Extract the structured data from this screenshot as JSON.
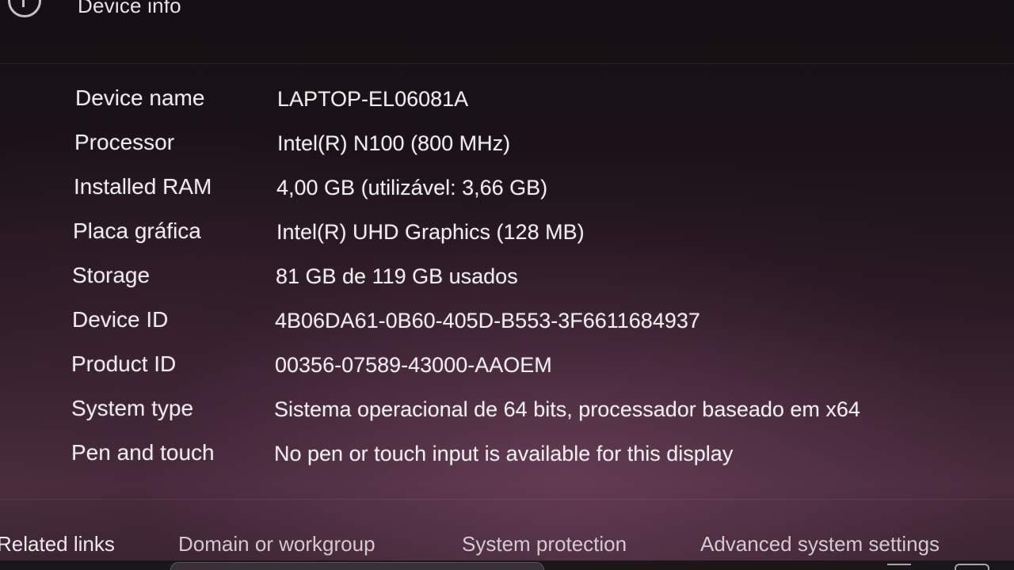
{
  "header": {
    "title": "Device info",
    "icon": "info-icon"
  },
  "specs": [
    {
      "label": "Device name",
      "value": "LAPTOP-EL06081A"
    },
    {
      "label": "Processor",
      "value": "Intel(R) N100 (800 MHz)"
    },
    {
      "label": "Installed RAM",
      "value": "4,00 GB (utilizável: 3,66 GB)"
    },
    {
      "label": "Placa gráfica",
      "value": "Intel(R) UHD Graphics (128 MB)"
    },
    {
      "label": "Storage",
      "value": "81 GB de 119 GB usados"
    },
    {
      "label": "Device ID",
      "value": "4B06DA61-0B60-405D-B553-3F6611684937"
    },
    {
      "label": "Product ID",
      "value": "00356-07589-43000-AAOEM"
    },
    {
      "label": "System type",
      "value": "Sistema operacional de 64 bits, processador baseado em x64"
    },
    {
      "label": "Pen and touch",
      "value": "No pen or touch input is available for this display"
    }
  ],
  "related": {
    "label": "Related links",
    "links": [
      "Domain or workgroup",
      "System protection",
      "Advanced system settings"
    ]
  }
}
